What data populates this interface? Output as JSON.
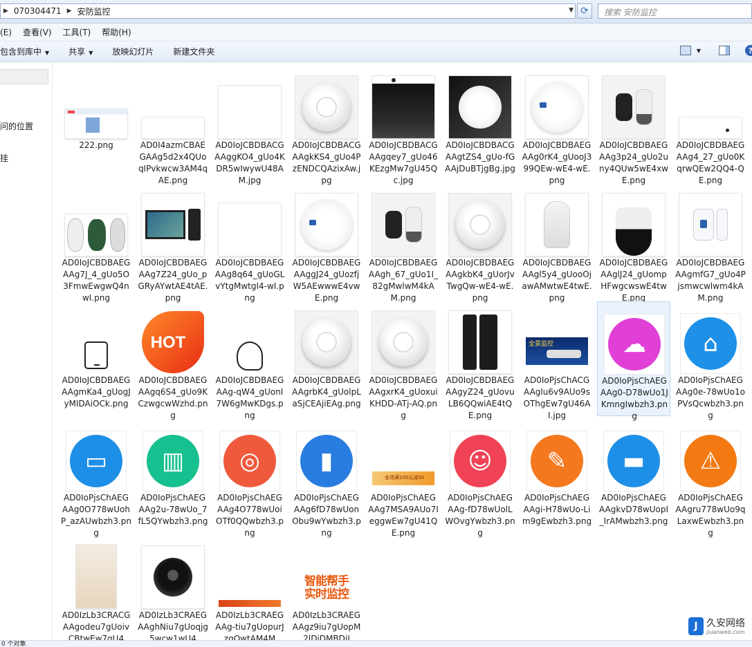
{
  "address": {
    "segments": [
      "070304471",
      "安防监控"
    ],
    "search_placeholder": "搜索 安防监控"
  },
  "menu": [
    "(E)",
    "查看(V)",
    "工具(T)",
    "帮助(H)"
  ],
  "toolbar": {
    "include_library": "包含到库中",
    "share": "共享",
    "slideshow": "放映幻灯片",
    "new_folder": "新建文件夹"
  },
  "nav": {
    "items": [
      "问的位置",
      "挂"
    ]
  },
  "files": [
    {
      "name": "222.png",
      "thumb": "screenshot"
    },
    {
      "name": "AD0I4azmCBAEGAAg5d2x4QUoqIPvkwcw3AM4qAE.png",
      "thumb": "blank-wide"
    },
    {
      "name": "AD0IoJCBDBACGAAggKO4_gUo4KDR5wIwywU48AM.jpg",
      "thumb": "blank"
    },
    {
      "name": "AD0IoJCBDBACGAAgkKS4_gUo4PzENDCQAzixAw.jpg",
      "thumb": "smoke-detector"
    },
    {
      "name": "AD0IoJCBDBACGAAgqey7_gUo46KEzgMw7gU45Qc.jpg",
      "thumb": "dark-panel"
    },
    {
      "name": "AD0IoJCBDBACGAAgtZS4_gUo-fGAAjDuBTjgBg.jpg",
      "thumb": "detector-dark"
    },
    {
      "name": "AD0IoJCBDBAEGAAg0rK4_gUooJ399QEw-wE4-wE.png",
      "thumb": "detector-wifi"
    },
    {
      "name": "AD0IoJCBDBAEGAAg3p24_gUo2uny4QUw5wE4xwE.png",
      "thumb": "sensor-pair"
    },
    {
      "name": "AD0IoJCBDBAEGAAg4_27_gUo0KqrwQEw2QQ4-QE.png",
      "thumb": "blank-wide"
    },
    {
      "name": "AD0IoJCBDBAEGAAg7J_4_gUo5O3FmwEwgwQ4nwI.png",
      "thumb": "detector-parts"
    },
    {
      "name": "AD0IoJCBDBAEGAAg7Z24_gUo_pGRyAYwtAE4tAE.png",
      "thumb": "video-door"
    },
    {
      "name": "AD0IoJCBDBAEGAAg8q64_gUoGLvYtgMwtgI4-wI.png",
      "thumb": "blank"
    },
    {
      "name": "AD0IoJCBDBAEGAAggJ24_gUozfjW5AEwwwE4vwE.png",
      "thumb": "detector-wifi"
    },
    {
      "name": "AD0IoJCBDBAEGAAgh_67_gUo1I_82gMwlwM4kAM.png",
      "thumb": "sensor-pair"
    },
    {
      "name": "AD0IoJCBDBAEGAAgkbK4_gUorJvTwgQw-wE4-wE.png",
      "thumb": "smoke-detector"
    },
    {
      "name": "AD0IoJCBDBAEGAAgl5y4_gUooOjawAMwtwE4twE.png",
      "thumb": "speaker"
    },
    {
      "name": "AD0IoJCBDBAEGAAglJ24_gUompHFwgcwswE4twE.png",
      "thumb": "dome-cam"
    },
    {
      "name": "AD0IoJCBDBAEGAAgmfG7_gUo4Pjsmwcwlwm4kAM.png",
      "thumb": "door-sensor"
    },
    {
      "name": "AD0IoJCBDBAEGAAgmKa4_gUogJyMIDAiOCk.png",
      "thumb": "tablet-icon"
    },
    {
      "name": "AD0IoJCBDBAEGAAgq6S4_gUo9KCzwgcwWzhd.png",
      "thumb": "hot"
    },
    {
      "name": "AD0IoJCBDBAEGAAg-qW4_gUonI7W6gMwKDgs.png",
      "thumb": "head-icon"
    },
    {
      "name": "AD0IoJCBDBAEGAAgrbK4_gUolpLaSjCEAjiEAg.png",
      "thumb": "smoke-detector"
    },
    {
      "name": "AD0IoJCBDBAEGAAgxrK4_gUoxuiKHDD-ATj-AQ.png",
      "thumb": "smoke-detector"
    },
    {
      "name": "AD0IoJCBDBAEGAAgyZ24_gUovuLB6QQwiAE4tQE.png",
      "thumb": "door-lock"
    },
    {
      "name": "AD0IoPjsChACGAAglu6v9AUo9sOThgEw7gU46AI.jpg",
      "thumb": "banner"
    },
    {
      "name": "AD0IoPjsChAEGAAg0-D78wUo1JKmngIwbzh3.png",
      "thumb": "app-cloud",
      "selected": true
    },
    {
      "name": "AD0IoPjsChAEGAAg0e-78wUo1oPVsQcwbzh3.png",
      "thumb": "app-home"
    },
    {
      "name": "AD0IoPjsChAEGAAg0O778wUohP_azAUwbzh3.png",
      "thumb": "app-monitor"
    },
    {
      "name": "AD0IoPjsChAEGAAg2u-78wUo_7fL5QYwbzh3.png",
      "thumb": "app-server"
    },
    {
      "name": "AD0IoPjsChAEGAAg4O778wUoiOTf0QQwbzh3.png",
      "thumb": "app-cam"
    },
    {
      "name": "AD0IoPjsChAEGAAg6fD78wUonObu9wYwbzh3.png",
      "thumb": "app-remote"
    },
    {
      "name": "AD0IoPjsChAEGAAg7MSA9AUo7IeggwEw7gU41QE.png",
      "thumb": "thin-banner"
    },
    {
      "name": "AD0IoPjsChAEGAAg-fD78wUolLWOvgYwbzh3.png",
      "thumb": "app-face"
    },
    {
      "name": "AD0IoPjsChAEGAAgi-H78wUo-Lim9gEwbzh3.png",
      "thumb": "app-tools"
    },
    {
      "name": "AD0IoPjsChAEGAAgkvD78wUopI_IrAMwbzh3.png",
      "thumb": "app-drive"
    },
    {
      "name": "AD0IoPjsChAEGAAgru778wUo9qLaxwEwbzh3.png",
      "thumb": "app-alarm"
    },
    {
      "name": "AD0IzLb3CRACGAAgodeu7gUoivCBtwEw7gU4",
      "thumb": "light-image"
    },
    {
      "name": "AD0IzLb3CRAEGAAghNiu7gUoqjg5wcw1wU4",
      "thumb": "ptz-cam"
    },
    {
      "name": "AD0IzLb3CRAEGAAg-tiu7gUopurJzgQwtAM4M",
      "thumb": "orange-strip"
    },
    {
      "name": "AD0IzLb3CRAEGAAgz9iu7gUopM2lDjDMBDiI",
      "thumb": "text-logo"
    }
  ],
  "thumb_text": {
    "hot": "HOT",
    "banner": "全景监控",
    "thin_banner": "全场满100元减30",
    "text_logo_line1": "智能帮手",
    "text_logo_line2": "实时监控"
  },
  "colors": {
    "app-cloud": "#e040d6",
    "app-home": "#1e90e8",
    "app-monitor": "#1e8fe6",
    "app-server": "#17c08f",
    "app-cam": "#f05a3c",
    "app-remote": "#2a7de0",
    "app-face": "#f04355",
    "app-tools": "#f4781e",
    "app-drive": "#1e8fe6",
    "app-alarm": "#f37a12"
  },
  "status": "0 个对象",
  "watermark": {
    "name": "久安网络",
    "url": "jiuanweb.com"
  }
}
